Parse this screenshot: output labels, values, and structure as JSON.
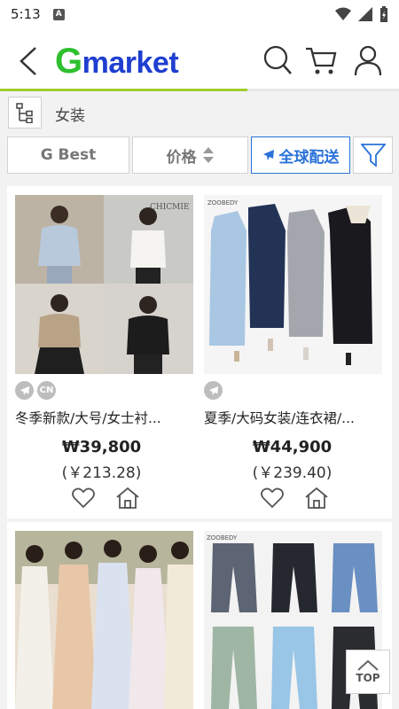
{
  "status": {
    "time": "5:13",
    "app_indicator": "A"
  },
  "header": {
    "logo_g": "G",
    "logo_rest": "market",
    "icons": [
      "back-icon",
      "search-icon",
      "cart-icon",
      "user-icon"
    ]
  },
  "page_progress": 0.62,
  "category": {
    "label": "女装"
  },
  "filters": {
    "g_best": "G Best",
    "price": "价格",
    "global": "全球配送"
  },
  "products": [
    {
      "title": "冬季新款/大号/女士衬...",
      "price": "₩39,800",
      "converted": "(￥213.28)",
      "badges": [
        "plane",
        "CN"
      ]
    },
    {
      "title": "夏季/大码女装/连衣裙/...",
      "price": "₩44,900",
      "converted": "(￥239.40)",
      "badges": [
        "plane"
      ]
    }
  ],
  "product_images": {
    "p1_text": "CHICMIE",
    "p2_text": "ZOOBEDY",
    "p4_text": "ZOOBEDY"
  },
  "top_button": {
    "label": "TOP"
  },
  "colors": {
    "brand_green": "#2ec02e",
    "brand_blue": "#1f3fd1",
    "accent_blue": "#2a72d9",
    "progress": "#9fce2c"
  }
}
